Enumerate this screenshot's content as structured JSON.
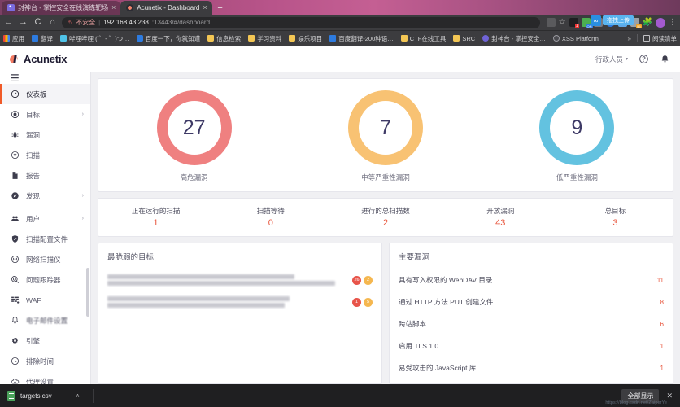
{
  "browser": {
    "tabs": [
      {
        "title": "封神台 - 掌控安全在线演练靶场",
        "icon": "shield-icon",
        "active": false
      },
      {
        "title": "Acunetix - Dashboard",
        "icon": "acunetix-icon",
        "active": true
      }
    ],
    "new_tab_label": "+",
    "tab_close_label": "×",
    "nav": {
      "back": "←",
      "forward": "→",
      "reload": "C",
      "home": "⌂"
    },
    "omnibox": {
      "security_icon": "⚠",
      "security_text": "不安全",
      "separator": "|",
      "url_host": "192.168.43.238",
      "url_rest": ":13443/#/dashboard"
    },
    "upload_chip": "拖拽上传",
    "toolbar_icons": [
      "translate-icon",
      "star-icon",
      "extension-recorder-icon",
      "extension-on-icon",
      "extension-gray-icon",
      "extension-blue-icon",
      "extension-clip-icon",
      "extension-badge-icon",
      "puzzle-icon",
      "profile-avatar",
      "chrome-menu-icon"
    ],
    "bookmarks": [
      {
        "label": "应用",
        "icon": "apps-grid-icon"
      },
      {
        "label": "翻译",
        "icon": "translate-bookmark-icon"
      },
      {
        "label": "哔哩哔哩 ( ゜- ゜)つ…",
        "icon": "bilibili-icon"
      },
      {
        "label": "百度一下，你就知道",
        "icon": "baidu-icon"
      },
      {
        "label": "信息检索",
        "icon": "folder-icon"
      },
      {
        "label": "学习资料",
        "icon": "folder-icon"
      },
      {
        "label": "娱乐项目",
        "icon": "folder-icon"
      },
      {
        "label": "百度翻译-200种语…",
        "icon": "translate-bookmark-icon"
      },
      {
        "label": "CTF在线工具",
        "icon": "folder-icon"
      },
      {
        "label": "SRC",
        "icon": "folder-icon"
      },
      {
        "label": "封神台 - 掌控安全…",
        "icon": "shield-icon"
      },
      {
        "label": "XSS Platform",
        "icon": "globe-icon"
      }
    ],
    "bookmarks_overflow": "»",
    "reading_list": {
      "label": "阅读清单",
      "icon": "reading-list-icon"
    }
  },
  "app": {
    "brand": "Acunetix",
    "user_menu": "行政人员",
    "user_caret": "▾",
    "help_icon": "?",
    "bell_icon": "≡"
  },
  "sidebar": {
    "hamburger": "☰",
    "groups": [
      {
        "items": [
          {
            "label": "仪表板",
            "icon": "dashboard-gauge-icon",
            "active": true,
            "chevron": ""
          },
          {
            "label": "目标",
            "icon": "target-icon",
            "active": false,
            "chevron": "›"
          },
          {
            "label": "漏洞",
            "icon": "bug-icon",
            "active": false,
            "chevron": ""
          },
          {
            "label": "扫描",
            "icon": "scan-radar-icon",
            "active": false,
            "chevron": ""
          },
          {
            "label": "报告",
            "icon": "report-document-icon",
            "active": false,
            "chevron": ""
          },
          {
            "label": "发现",
            "icon": "discovery-compass-icon",
            "active": false,
            "chevron": "›"
          }
        ]
      },
      {
        "items": [
          {
            "label": "用户",
            "icon": "users-icon",
            "active": false,
            "chevron": "›"
          },
          {
            "label": "扫描配置文件",
            "icon": "shield-config-icon",
            "active": false,
            "chevron": ""
          },
          {
            "label": "网络扫描仪",
            "icon": "network-scanner-icon",
            "active": false,
            "chevron": ""
          },
          {
            "label": "问题跟踪器",
            "icon": "issue-tracker-icon",
            "active": false,
            "chevron": ""
          },
          {
            "label": "WAF",
            "icon": "waf-icon",
            "active": false,
            "chevron": ""
          },
          {
            "label": "电子邮件设置",
            "icon": "bell-icon",
            "active": false,
            "chevron": "",
            "blurred": true
          },
          {
            "label": "引擎",
            "icon": "engine-gear-icon",
            "active": false,
            "chevron": ""
          },
          {
            "label": "排除时间",
            "icon": "clock-icon",
            "active": false,
            "chevron": ""
          },
          {
            "label": "代理设置",
            "icon": "cloud-proxy-icon",
            "active": false,
            "chevron": ""
          }
        ]
      }
    ]
  },
  "dashboard": {
    "donuts": [
      {
        "value": "27",
        "label": "高危漏洞",
        "color": "#ef8080"
      },
      {
        "value": "7",
        "label": "中等严重性漏洞",
        "color": "#f8c273"
      },
      {
        "value": "9",
        "label": "低严重性漏洞",
        "color": "#63c2e0"
      }
    ],
    "stats": [
      {
        "label": "正在运行的扫描",
        "value": "1"
      },
      {
        "label": "扫描等待",
        "value": "0"
      },
      {
        "label": "进行的总扫描数",
        "value": "2"
      },
      {
        "label": "开放漏洞",
        "value": "43"
      },
      {
        "label": "总目标",
        "value": "3"
      }
    ],
    "vulnerable_targets": {
      "title": "最脆弱的目标",
      "rows": [
        {
          "name_redacted": true,
          "high": "26",
          "medium": "2"
        },
        {
          "name_redacted": true,
          "high": "1",
          "medium": "5"
        }
      ]
    },
    "top_vulnerabilities": {
      "title": "主要漏洞",
      "rows": [
        {
          "name": "具有写入权限的 WebDAV 目录",
          "count": "11"
        },
        {
          "name": "通过 HTTP 方法 PUT 创建文件",
          "count": "8"
        },
        {
          "name": "跨站脚本",
          "count": "6"
        },
        {
          "name": "启用 TLS 1.0",
          "count": "1"
        },
        {
          "name": "易受攻击的 JavaScript 库",
          "count": "1"
        }
      ]
    }
  },
  "downloadbar": {
    "file_name": "targets.csv",
    "file_chevron": "ʌ",
    "show_all": "全部显示",
    "close": "✕",
    "watermark": "https://blog.csdn.net/ZaiperYe"
  }
}
